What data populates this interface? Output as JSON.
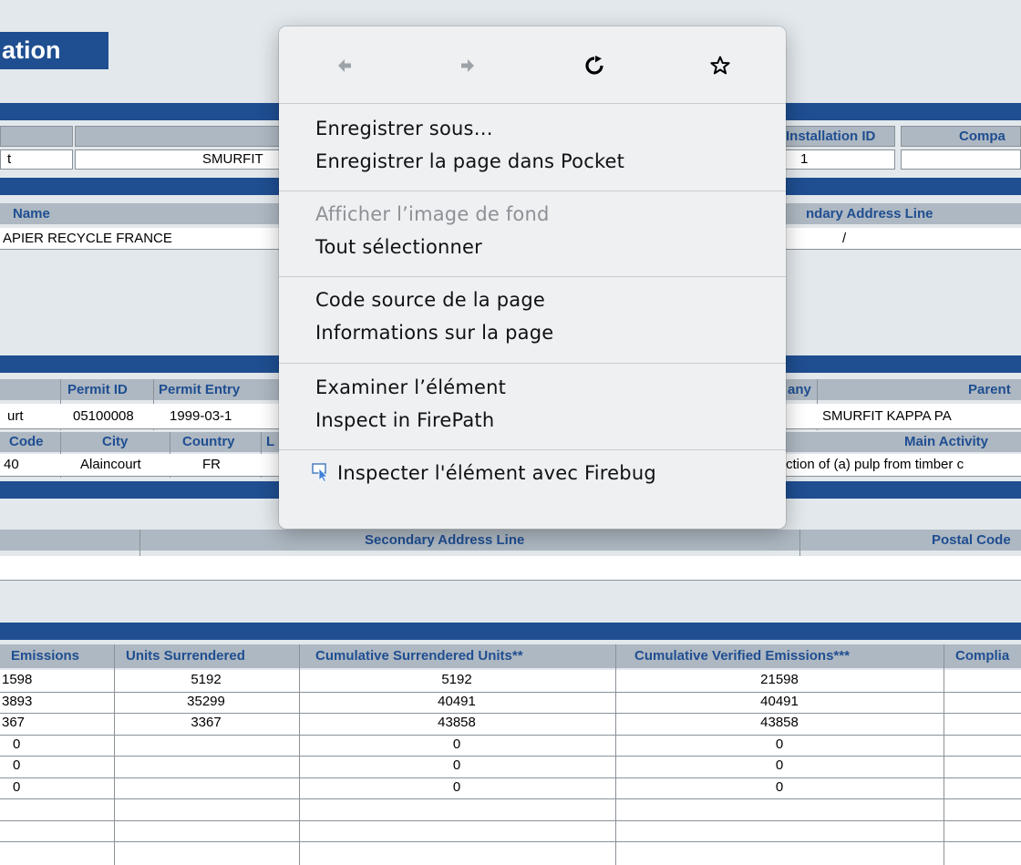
{
  "page": {
    "title": "ation"
  },
  "installation": {
    "headers": [
      "Installation ID",
      "Compa"
    ],
    "row": {
      "col0": "t",
      "name": "SMURFIT",
      "id": "1"
    }
  },
  "name_section": {
    "headers": [
      "Name",
      "ndary Address Line"
    ],
    "row": {
      "name": "APIER RECYCLE FRANCE",
      "sec_addr": "/"
    }
  },
  "permit": {
    "headers": [
      "Permit ID",
      "Permit Entry",
      "any",
      "Parent"
    ],
    "row": {
      "city": "urt",
      "permit_id": "05100008",
      "entry": "1999-03-1",
      "parent": "SMURFIT KAPPA PA"
    }
  },
  "location": {
    "headers": [
      "Code",
      "City",
      "Country",
      "L",
      "Main Activity"
    ],
    "row": {
      "code": "40",
      "city": "Alaincourt",
      "country": "FR",
      "activity": "ction of (a) pulp from timber c"
    }
  },
  "address": {
    "headers": [
      "Secondary Address Line",
      "Postal Code"
    ]
  },
  "compliance": {
    "headers": [
      "Emissions",
      "Units Surrendered",
      "Cumulative Surrendered Units**",
      "Cumulative Verified Emissions***",
      "Complia"
    ],
    "rows": [
      [
        "1598",
        "5192",
        "5192",
        "21598"
      ],
      [
        "3893",
        "35299",
        "40491",
        "40491"
      ],
      [
        "367",
        "3367",
        "43858",
        "43858"
      ],
      [
        "0",
        "",
        "0",
        "0"
      ],
      [
        "0",
        "",
        "0",
        "0"
      ],
      [
        "0",
        "",
        "0",
        "0"
      ],
      [
        "",
        "",
        "",
        ""
      ],
      [
        "",
        "",
        "",
        ""
      ]
    ]
  },
  "context_menu": {
    "nav": {
      "back_icon": "arrow-left-icon",
      "forward_icon": "arrow-right-icon",
      "reload_icon": "reload-icon",
      "bookmark_icon": "star-icon"
    },
    "items": {
      "save_as": "Enregistrer sous…",
      "save_pocket": "Enregistrer la page dans Pocket",
      "view_bg_image": "Afficher l’image de fond",
      "select_all": "Tout sélectionner",
      "view_source": "Code source de la page",
      "page_info": "Informations sur la page",
      "inspect": "Examiner l’élément",
      "firepath": "Inspect in FirePath",
      "firebug": "Inspecter l'élément avec Firebug"
    }
  },
  "colors": {
    "header_blue": "#1f4e91",
    "header_gray": "#aeb8c2",
    "page_bg": "#e2e8ec",
    "menu_bg": "#eef0f2"
  }
}
